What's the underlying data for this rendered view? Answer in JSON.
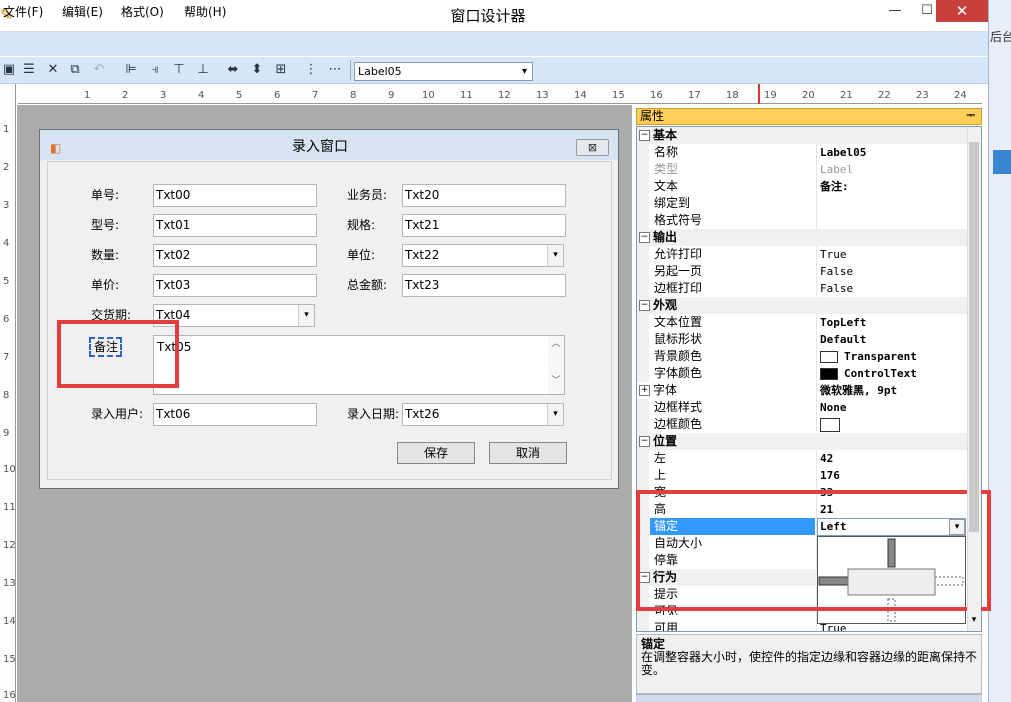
{
  "window": {
    "title": "窗口设计器",
    "min": "—",
    "max": "☐",
    "close": "✕"
  },
  "background_app": {
    "text": "后台"
  },
  "menu": [
    {
      "label": "文件(F)"
    },
    {
      "label": "编辑(E)"
    },
    {
      "label": "格式(O)"
    },
    {
      "label": "帮助(H)"
    }
  ],
  "toolbar": {
    "icons": [
      "save-icon",
      "properties-icon",
      "delete-icon",
      "copy-icon",
      "undo-icon",
      "align-left-icon",
      "align-right-icon",
      "align-top-icon",
      "align-bottom-icon",
      "same-width-icon",
      "same-height-icon",
      "same-size-icon",
      "vertical-spacing-icon",
      "horizontal-spacing-icon"
    ],
    "control_select": "Label05",
    "select_arrow": "▾"
  },
  "ruler": {
    "top": [
      "1",
      "2",
      "3",
      "4",
      "5",
      "6",
      "7",
      "8",
      "9",
      "10",
      "11",
      "12",
      "13",
      "14",
      "15",
      "16",
      "17",
      "18",
      "19",
      "20",
      "21",
      "22",
      "23",
      "24"
    ],
    "left": [
      "1",
      "2",
      "3",
      "4",
      "5",
      "6",
      "7",
      "8",
      "9",
      "10",
      "11",
      "12",
      "13",
      "14",
      "15",
      "16"
    ]
  },
  "form": {
    "title": "录入窗口",
    "close": "⊠",
    "fields": [
      {
        "label": "单号:",
        "value": "Txt00"
      },
      {
        "label": "型号:",
        "value": "Txt01"
      },
      {
        "label": "数量:",
        "value": "Txt02"
      },
      {
        "label": "单价:",
        "value": "Txt03"
      },
      {
        "label": "交货期:",
        "value": "Txt04"
      },
      {
        "label": "业务员:",
        "value": "Txt20"
      },
      {
        "label": "规格:",
        "value": "Txt21"
      },
      {
        "label": "单位:",
        "value": "Txt22"
      },
      {
        "label": "总金额:",
        "value": "Txt23"
      }
    ],
    "memo_label": "备注",
    "memo_value": "Txt05",
    "user_label": "录入用户:",
    "user_value": "Txt06",
    "date_label": "录入日期:",
    "date_value": "Txt26",
    "save_button": "保存",
    "cancel_button": "取消",
    "arrow": "▾",
    "scroll_up": "︿",
    "scroll_down": "﹀"
  },
  "properties": {
    "header": "属性",
    "pin": "ᆍ",
    "categories": {
      "basic": "基本",
      "output": "输出",
      "appearance": "外观",
      "position": "位置",
      "behavior": "行为"
    },
    "rows": {
      "name": {
        "label": "名称",
        "value": "Label05"
      },
      "type": {
        "label": "类型",
        "value": "Label"
      },
      "text": {
        "label": "文本",
        "value": "备注:"
      },
      "bind": {
        "label": "绑定到",
        "value": ""
      },
      "format": {
        "label": "格式符号",
        "value": ""
      },
      "allow_print": {
        "label": "允许打印",
        "value": "True"
      },
      "new_page": {
        "label": "另起一页",
        "value": "False"
      },
      "border_print": {
        "label": "边框打印",
        "value": "False"
      },
      "text_align": {
        "label": "文本位置",
        "value": "TopLeft"
      },
      "cursor": {
        "label": "鼠标形状",
        "value": "Default"
      },
      "back_color": {
        "label": "背景颜色",
        "value": "Transparent"
      },
      "fore_color": {
        "label": "字体颜色",
        "value": "ControlText"
      },
      "font": {
        "label": "字体",
        "value": "微软雅黑, 9pt"
      },
      "border_style": {
        "label": "边框样式",
        "value": "None"
      },
      "border_color": {
        "label": "边框颜色",
        "value": ""
      },
      "left": {
        "label": "左",
        "value": "42"
      },
      "top": {
        "label": "上",
        "value": "176"
      },
      "width": {
        "label": "宽",
        "value": "33"
      },
      "height": {
        "label": "高",
        "value": "21"
      },
      "anchor": {
        "label": "锚定",
        "value": "Left"
      },
      "autosize": {
        "label": "自动大小",
        "value": ""
      },
      "dock": {
        "label": "停靠",
        "value": ""
      },
      "tooltip": {
        "label": "提示",
        "value": ""
      },
      "visible": {
        "label": "可见",
        "value": ""
      },
      "enabled": {
        "label": "可用",
        "value": "True"
      }
    },
    "description_title": "锚定",
    "description_text": "在调整容器大小时，使控件的指定边缘和容器边缘的距离保持不变。"
  },
  "colors": {
    "highlight": "#e33e3e",
    "selection": "#3399ff",
    "prop_header": "#ffcf5a"
  }
}
